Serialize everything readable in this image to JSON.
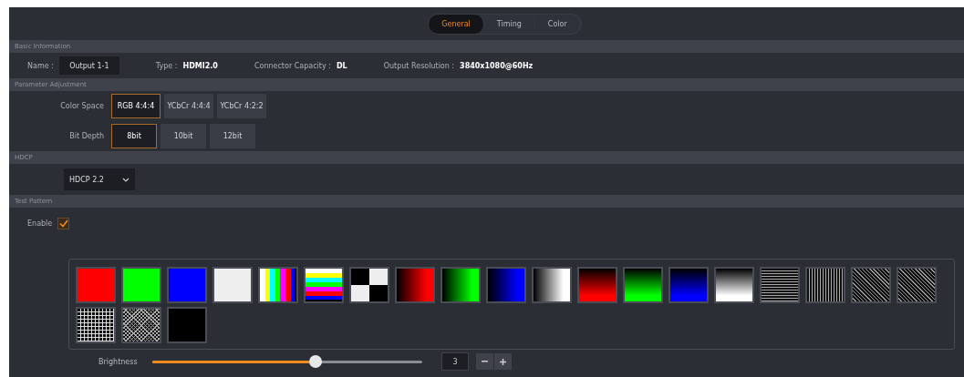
{
  "tabs": [
    {
      "label": "General",
      "selected": true
    },
    {
      "label": "Timing",
      "selected": false
    },
    {
      "label": "Color",
      "selected": false
    }
  ],
  "basic_information": {
    "header": "Basic Information",
    "name_label": "Name :",
    "name_value": "Output 1-1",
    "type_label": "Type :",
    "type_value": "HDMI2.0",
    "capacity_label": "Connector Capacity :",
    "capacity_value": "DL",
    "resolution_label": "Output Resolution :",
    "resolution_value": "3840x1080@60Hz"
  },
  "parameter_adjustment": {
    "header": "Parameter Adjustment",
    "color_space": {
      "label": "Color Space",
      "options": [
        {
          "label": "RGB 4:4:4",
          "selected": true
        },
        {
          "label": "YCbCr 4:4:4",
          "selected": false
        },
        {
          "label": "YCbCr 4:2:2",
          "selected": false
        }
      ]
    },
    "bit_depth": {
      "label": "Bit Depth",
      "options": [
        {
          "label": "8bit",
          "selected": true
        },
        {
          "label": "10bit",
          "selected": false
        },
        {
          "label": "12bit",
          "selected": false
        }
      ]
    }
  },
  "hdcp": {
    "header": "HDCP",
    "value": "HDCP 2.2"
  },
  "test_pattern": {
    "header": "Test Pattern",
    "enable_label": "Enable",
    "enabled": true,
    "patterns": [
      {
        "kind": "solid",
        "color": "#ff0000"
      },
      {
        "kind": "solid",
        "color": "#00ff00"
      },
      {
        "kind": "solid",
        "color": "#0000ff"
      },
      {
        "kind": "solid",
        "color": "#eeeeee"
      },
      {
        "kind": "vbars"
      },
      {
        "kind": "hbars"
      },
      {
        "kind": "checker"
      },
      {
        "kind": "hgradient",
        "color": "#ff0000"
      },
      {
        "kind": "hgradient",
        "color": "#00ff00"
      },
      {
        "kind": "hgradient",
        "color": "#0000ff"
      },
      {
        "kind": "hgradient",
        "color": "#ffffff"
      },
      {
        "kind": "vgradient",
        "color": "#ff0000"
      },
      {
        "kind": "vgradient",
        "color": "#00ff00"
      },
      {
        "kind": "vgradient",
        "color": "#0000ff"
      },
      {
        "kind": "vgradient",
        "color": "#ffffff"
      },
      {
        "kind": "hlines"
      },
      {
        "kind": "vlines"
      },
      {
        "kind": "diagonal"
      },
      {
        "kind": "diagonal"
      },
      {
        "kind": "grid"
      },
      {
        "kind": "crosshatch"
      },
      {
        "kind": "solid",
        "color": "#000000"
      }
    ],
    "brightness": {
      "label": "Brightness",
      "level": 0.58,
      "value": "3"
    }
  }
}
